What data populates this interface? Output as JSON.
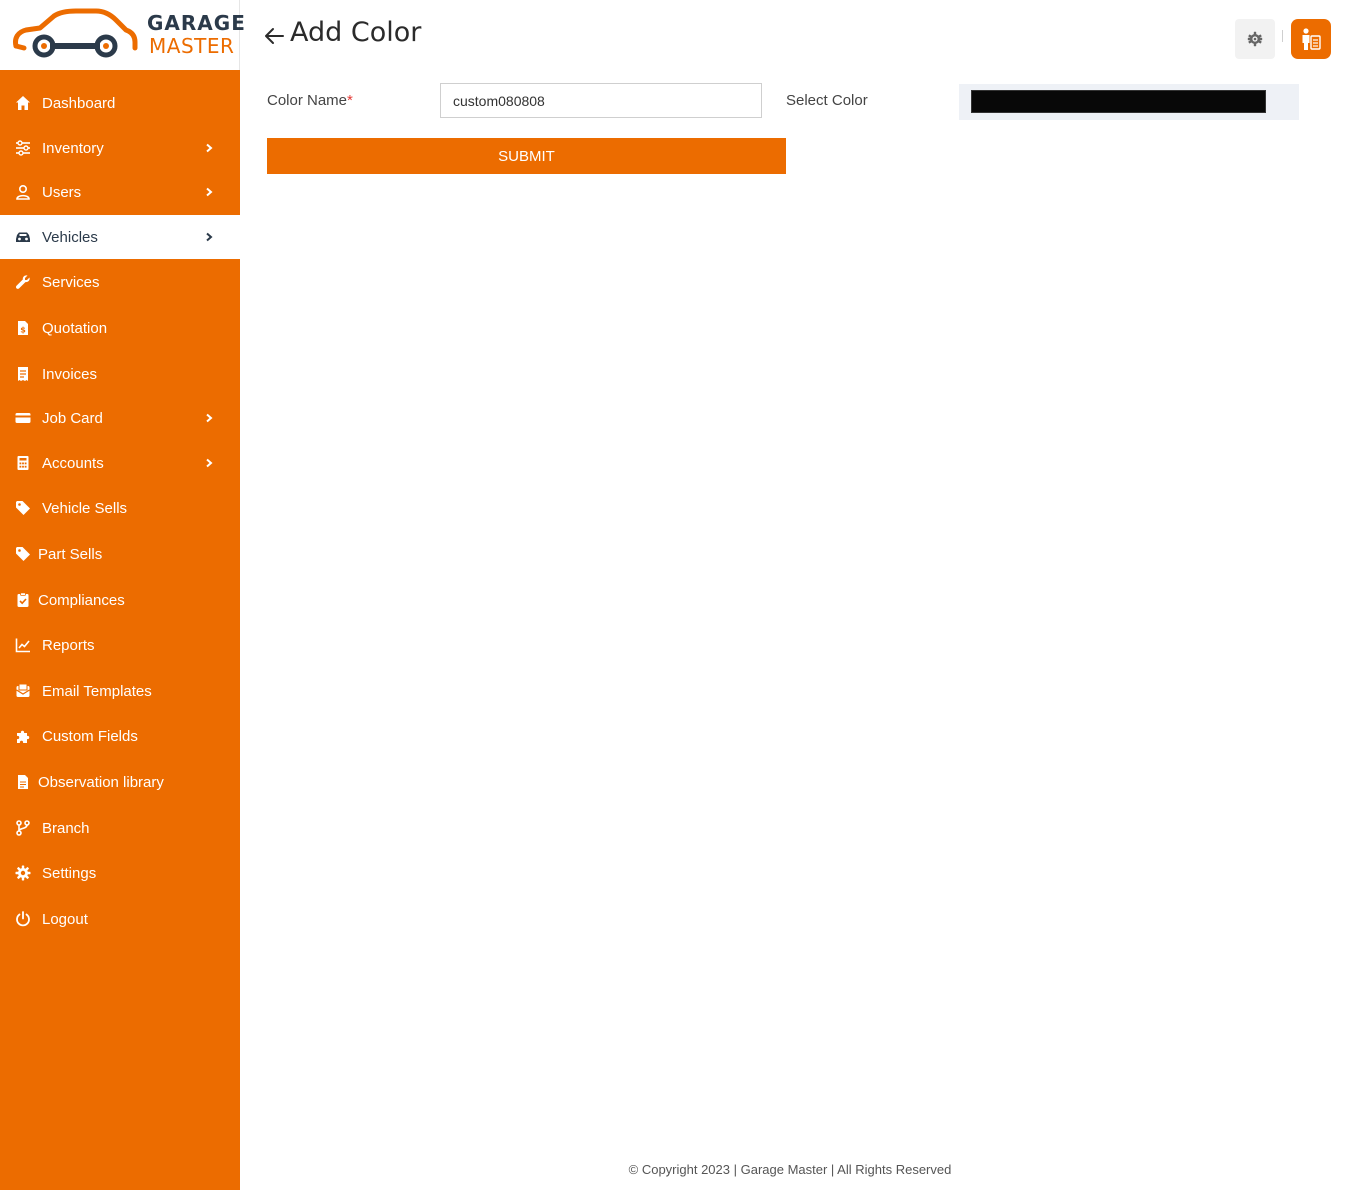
{
  "brand": {
    "line1": "GARAGE",
    "line2": "MASTER",
    "accent": "#ec6c00",
    "dark": "#2b3a4a"
  },
  "sidebar": {
    "items": [
      {
        "label": "Dashboard",
        "icon": "home-icon",
        "submenu": false,
        "active": false
      },
      {
        "label": "Inventory",
        "icon": "sliders-icon",
        "submenu": true,
        "active": false
      },
      {
        "label": "Users",
        "icon": "user-icon",
        "submenu": true,
        "active": false
      },
      {
        "label": "Vehicles",
        "icon": "car-icon",
        "submenu": true,
        "active": true
      },
      {
        "label": "Services",
        "icon": "wrench-icon",
        "submenu": false,
        "active": false
      },
      {
        "label": "Quotation",
        "icon": "file-dollar-icon",
        "submenu": false,
        "active": false
      },
      {
        "label": "Invoices",
        "icon": "receipt-icon",
        "submenu": false,
        "active": false
      },
      {
        "label": "Job Card",
        "icon": "credit-card-icon",
        "submenu": true,
        "active": false
      },
      {
        "label": "Accounts",
        "icon": "calculator-icon",
        "submenu": true,
        "active": false
      },
      {
        "label": "Vehicle Sells",
        "icon": "tag-icon",
        "submenu": false,
        "active": false
      },
      {
        "label": "Part Sells",
        "icon": "tag-icon",
        "submenu": false,
        "active": false
      },
      {
        "label": "Compliances",
        "icon": "clipboard-check-icon",
        "submenu": false,
        "active": false
      },
      {
        "label": "Reports",
        "icon": "line-chart-icon",
        "submenu": false,
        "active": false
      },
      {
        "label": "Email Templates",
        "icon": "mail-box-icon",
        "submenu": false,
        "active": false
      },
      {
        "label": "Custom Fields",
        "icon": "puzzle-icon",
        "submenu": false,
        "active": false
      },
      {
        "label": "Observation library",
        "icon": "file-icon",
        "submenu": false,
        "active": false
      },
      {
        "label": "Branch",
        "icon": "branch-icon",
        "submenu": false,
        "active": false
      },
      {
        "label": "Settings",
        "icon": "gear-icon",
        "submenu": false,
        "active": false
      },
      {
        "label": "Logout",
        "icon": "power-icon",
        "submenu": false,
        "active": false
      }
    ]
  },
  "header": {
    "title": "Add Color"
  },
  "form": {
    "color_name_label": "Color Name",
    "required_mark": "*",
    "color_name_value": "custom080808",
    "select_color_label": "Select Color",
    "selected_color": "#080808",
    "submit_label": "SUBMIT"
  },
  "footer": {
    "text": "© Copyright 2023 | Garage Master | All Rights Reserved"
  }
}
